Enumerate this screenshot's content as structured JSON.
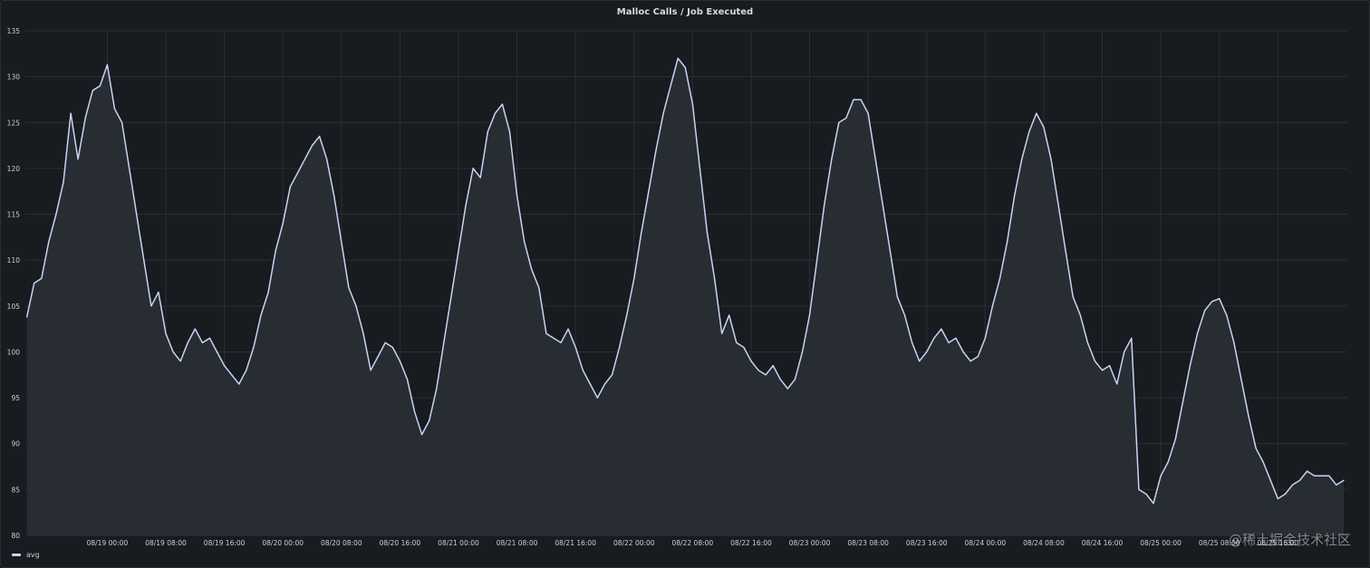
{
  "panel": {
    "title": "Malloc Calls / Job Executed",
    "watermark": "@稀土掘金技术社区"
  },
  "colors": {
    "background": "#181b1f",
    "line": "#c8d3f5",
    "fill": "#2c3038",
    "grid": "#2c2f35"
  },
  "chart_data": {
    "type": "area",
    "title": "Malloc Calls / Job Executed",
    "xlabel": "",
    "ylabel": "",
    "ylim": [
      80,
      135
    ],
    "yticks": [
      "80",
      "85",
      "90",
      "95",
      "100",
      "105",
      "110",
      "115",
      "120",
      "125",
      "130",
      "135"
    ],
    "x_range_hours": [
      -11.2,
      169.5
    ],
    "xticks": [
      {
        "label": "08/19 00:00",
        "hour": 0
      },
      {
        "label": "08/19 08:00",
        "hour": 8
      },
      {
        "label": "08/19 16:00",
        "hour": 16
      },
      {
        "label": "08/20 00:00",
        "hour": 24
      },
      {
        "label": "08/20 08:00",
        "hour": 32
      },
      {
        "label": "08/20 16:00",
        "hour": 40
      },
      {
        "label": "08/21 00:00",
        "hour": 48
      },
      {
        "label": "08/21 08:00",
        "hour": 56
      },
      {
        "label": "08/21 16:00",
        "hour": 64
      },
      {
        "label": "08/22 00:00",
        "hour": 72
      },
      {
        "label": "08/22 08:00",
        "hour": 80
      },
      {
        "label": "08/22 16:00",
        "hour": 88
      },
      {
        "label": "08/23 00:00",
        "hour": 96
      },
      {
        "label": "08/23 08:00",
        "hour": 104
      },
      {
        "label": "08/23 16:00",
        "hour": 112
      },
      {
        "label": "08/24 00:00",
        "hour": 120
      },
      {
        "label": "08/24 08:00",
        "hour": 128
      },
      {
        "label": "08/24 16:00",
        "hour": 136
      },
      {
        "label": "08/25 00:00",
        "hour": 144
      },
      {
        "label": "08/25 08:00",
        "hour": 152
      },
      {
        "label": "08/25 16:00",
        "hour": 160
      }
    ],
    "legend_placement": "bottom-left",
    "grid": true,
    "series": [
      {
        "name": "avg",
        "x_hours": [
          -11,
          -10,
          -9,
          -8,
          -7,
          -6,
          -5,
          -4,
          -3,
          -2,
          -1,
          0,
          1,
          2,
          3,
          4,
          5,
          6,
          7,
          8,
          9,
          10,
          11,
          12,
          13,
          14,
          15,
          16,
          17,
          18,
          19,
          20,
          21,
          22,
          23,
          24,
          25,
          26,
          27,
          28,
          29,
          30,
          31,
          32,
          33,
          34,
          35,
          36,
          37,
          38,
          39,
          40,
          41,
          42,
          43,
          44,
          45,
          46,
          47,
          48,
          49,
          50,
          51,
          52,
          53,
          54,
          55,
          56,
          57,
          58,
          59,
          60,
          61,
          62,
          63,
          64,
          65,
          66,
          67,
          68,
          69,
          70,
          71,
          72,
          73,
          74,
          75,
          76,
          77,
          78,
          79,
          80,
          81,
          82,
          83,
          84,
          85,
          86,
          87,
          88,
          89,
          90,
          91,
          92,
          93,
          94,
          95,
          96,
          97,
          98,
          99,
          100,
          101,
          102,
          103,
          104,
          105,
          106,
          107,
          108,
          109,
          110,
          111,
          112,
          113,
          114,
          115,
          116,
          117,
          118,
          119,
          120,
          121,
          122,
          123,
          124,
          125,
          126,
          127,
          128,
          129,
          130,
          131,
          132,
          133,
          134,
          135,
          136,
          137,
          138,
          139,
          140,
          141,
          142,
          143,
          144,
          145,
          146,
          147,
          148,
          149,
          150,
          151,
          152,
          153,
          154,
          155,
          156,
          157,
          158,
          159,
          160,
          161,
          162,
          163,
          164,
          165,
          166,
          167,
          168,
          169
        ],
        "values": [
          103.8,
          107.5,
          108.0,
          112.0,
          115.0,
          118.5,
          126.0,
          121.0,
          125.5,
          128.5,
          129.0,
          131.3,
          126.5,
          125.0,
          120.0,
          115.0,
          110.0,
          105.0,
          106.5,
          102.0,
          100.0,
          99.0,
          101.0,
          102.5,
          101.0,
          101.5,
          100.0,
          98.5,
          97.5,
          96.5,
          98.0,
          100.5,
          104.0,
          106.5,
          111.0,
          114.0,
          118.0,
          119.5,
          121.0,
          122.5,
          123.5,
          121.0,
          117.0,
          112.0,
          107.0,
          105.0,
          102.0,
          98.0,
          99.5,
          101.0,
          100.5,
          99.0,
          97.0,
          93.5,
          91.0,
          92.5,
          96.0,
          101.0,
          106.0,
          111.0,
          116.0,
          120.0,
          119.0,
          124.0,
          126.0,
          127.0,
          124.0,
          117.0,
          112.0,
          109.0,
          107.0,
          102.0,
          101.5,
          101.0,
          102.5,
          100.5,
          98.0,
          96.5,
          95.0,
          96.5,
          97.5,
          100.5,
          104.0,
          108.0,
          113.0,
          117.5,
          122.0,
          126.0,
          129.0,
          132.0,
          131.0,
          127.0,
          120.0,
          113.0,
          108.0,
          102.0,
          104.0,
          101.0,
          100.5,
          99.0,
          98.0,
          97.5,
          98.5,
          97.0,
          96.0,
          97.0,
          100.0,
          104.0,
          110.0,
          116.0,
          121.0,
          125.0,
          125.5,
          127.5,
          127.5,
          126.0,
          121.0,
          116.0,
          111.0,
          106.0,
          104.0,
          101.0,
          99.0,
          100.0,
          101.5,
          102.5,
          101.0,
          101.5,
          100.0,
          99.0,
          99.5,
          101.5,
          105.0,
          108.0,
          112.0,
          117.0,
          121.0,
          124.0,
          126.0,
          124.5,
          121.0,
          116.0,
          111.0,
          106.0,
          104.0,
          101.0,
          99.0,
          98.0,
          98.5,
          96.5,
          100.0,
          101.5,
          85.0,
          84.5,
          83.5,
          86.5,
          88.0,
          90.5,
          94.5,
          98.5,
          102.0,
          104.5,
          105.5,
          105.8,
          104.0,
          101.0,
          97.0,
          93.0,
          89.5,
          88.0,
          86.0,
          84.0,
          84.5,
          85.5,
          86.0,
          87.0,
          86.5,
          86.5,
          86.5,
          85.5,
          86.0,
          88.5
        ]
      }
    ]
  }
}
